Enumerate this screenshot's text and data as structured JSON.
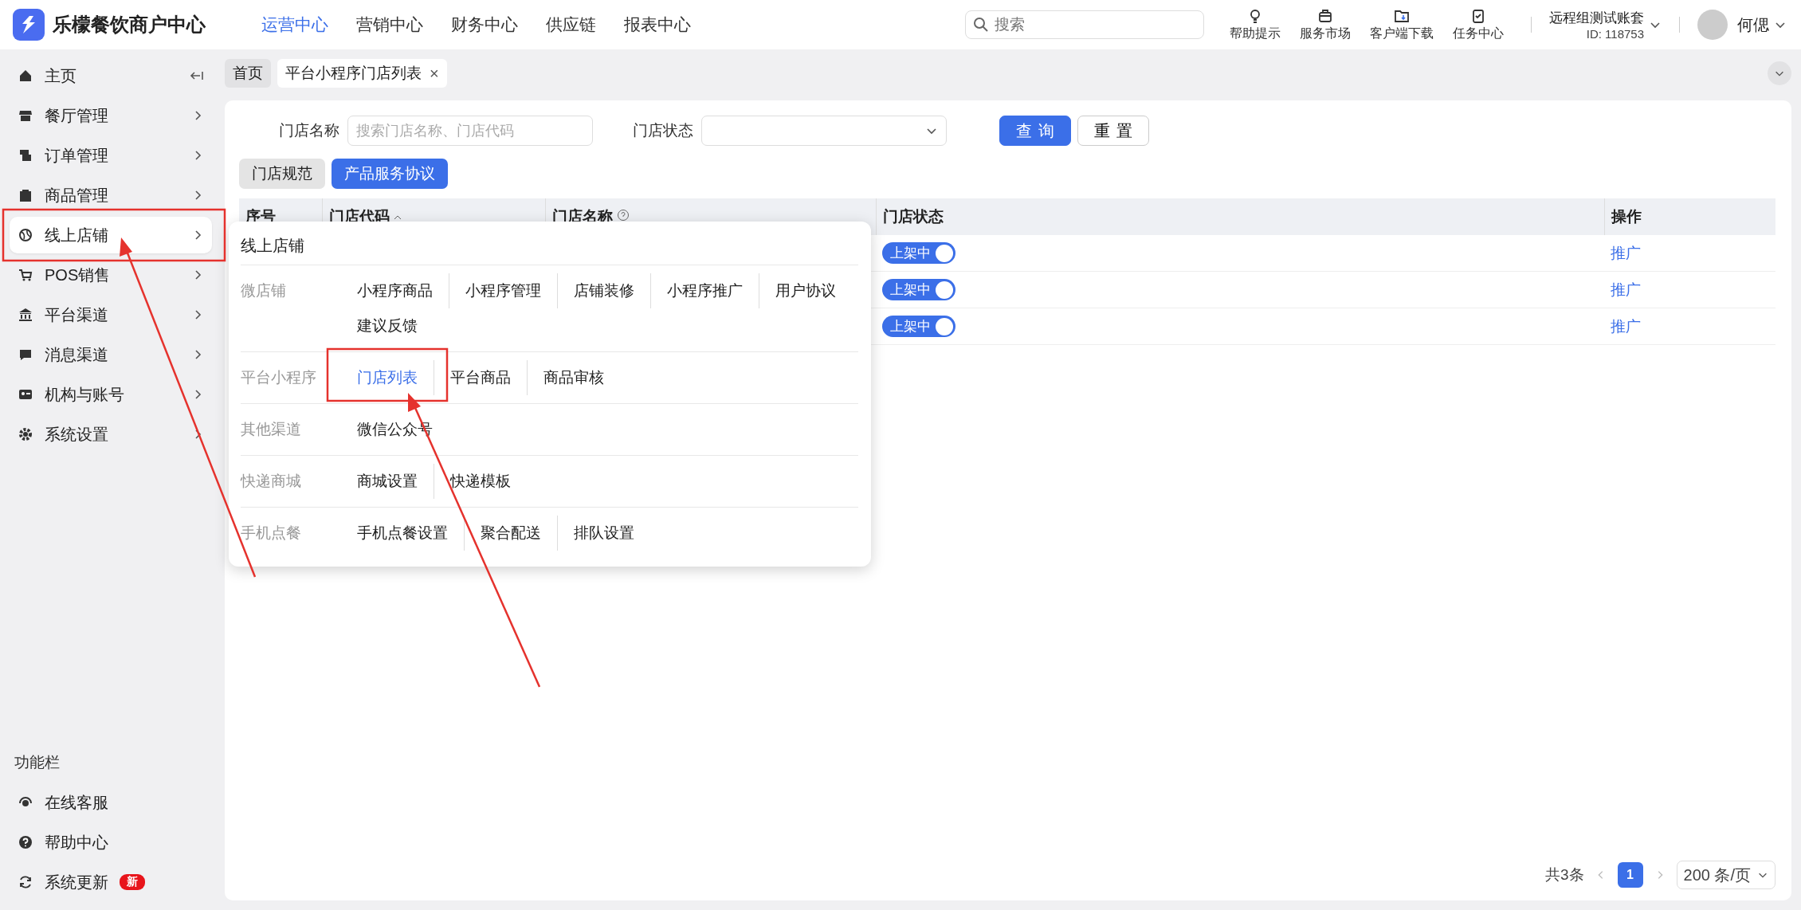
{
  "app": {
    "name": "乐檬餐饮商户中心"
  },
  "top_nav": [
    {
      "label": "运营中心",
      "selected": true
    },
    {
      "label": "营销中心",
      "selected": false
    },
    {
      "label": "财务中心",
      "selected": false
    },
    {
      "label": "供应链",
      "selected": false
    },
    {
      "label": "报表中心",
      "selected": false
    }
  ],
  "search": {
    "placeholder": "搜索"
  },
  "tools": [
    {
      "label": "帮助提示"
    },
    {
      "label": "服务市场"
    },
    {
      "label": "客户端下载"
    },
    {
      "label": "任务中心"
    }
  ],
  "account": {
    "name": "远程组测试账套",
    "id": "ID: 118753"
  },
  "user": {
    "name": "何偲"
  },
  "sidebar": {
    "items": [
      {
        "label": "主页",
        "kind": "collapse",
        "selected": false
      },
      {
        "label": "餐厅管理",
        "kind": "submenu",
        "selected": false
      },
      {
        "label": "订单管理",
        "kind": "submenu",
        "selected": false
      },
      {
        "label": "商品管理",
        "kind": "submenu",
        "selected": false
      },
      {
        "label": "线上店铺",
        "kind": "submenu",
        "selected": true
      },
      {
        "label": "POS销售",
        "kind": "submenu",
        "selected": false
      },
      {
        "label": "平台渠道",
        "kind": "submenu",
        "selected": false
      },
      {
        "label": "消息渠道",
        "kind": "submenu",
        "selected": false
      },
      {
        "label": "机构与账号",
        "kind": "submenu",
        "selected": false
      },
      {
        "label": "系统设置",
        "kind": "submenu",
        "selected": false
      }
    ],
    "footer_title": "功能栏",
    "footer_items": [
      {
        "label": "在线客服"
      },
      {
        "label": "帮助中心"
      },
      {
        "label": "系统更新",
        "badge": "新"
      }
    ]
  },
  "page_tabs": [
    {
      "label": "首页",
      "selected": false
    },
    {
      "label": "平台小程序门店列表",
      "selected": true,
      "close": "×"
    }
  ],
  "filters": [
    {
      "label": "门店名称",
      "kind": "text",
      "placeholder": "搜索门店名称、门店代码"
    },
    {
      "label": "门店状态",
      "kind": "select"
    }
  ],
  "buttons": [
    {
      "label": "查询",
      "kind": "primary"
    },
    {
      "label": "重置",
      "kind": "default"
    }
  ],
  "subtabs": [
    {
      "label": "门店规范",
      "selected": false
    },
    {
      "label": "产品服务协议",
      "selected": true
    }
  ],
  "table": {
    "columns": [
      {
        "label": "序号"
      },
      {
        "label": "门店代码",
        "sortable": true
      },
      {
        "label": "门店名称",
        "help": true
      },
      {
        "label": "门店状态"
      },
      {
        "label": "操作"
      }
    ],
    "rows": [
      {
        "status": "上架中",
        "on": true,
        "action": "推广"
      },
      {
        "status": "上架中",
        "on": true,
        "action": "推广"
      },
      {
        "status": "上架中",
        "on": true,
        "action": "推广"
      }
    ]
  },
  "pagination": {
    "total": "共3条",
    "pages": [
      {
        "label": "1",
        "selected": true
      }
    ],
    "page_size": "200 条/页"
  },
  "flyout": {
    "title": "线上店铺",
    "groups": [
      {
        "label": "微店铺",
        "links": [
          {
            "label": "小程序商品",
            "selected": false
          },
          {
            "label": "小程序管理",
            "selected": false
          },
          {
            "label": "店铺装修",
            "selected": false
          },
          {
            "label": "小程序推广",
            "selected": false
          },
          {
            "label": "用户协议",
            "selected": false
          },
          {
            "label": "建议反馈",
            "selected": false
          }
        ]
      },
      {
        "label": "平台小程序",
        "links": [
          {
            "label": "门店列表",
            "selected": true
          },
          {
            "label": "平台商品",
            "selected": false
          },
          {
            "label": "商品审核",
            "selected": false
          }
        ]
      },
      {
        "label": "其他渠道",
        "links": [
          {
            "label": "微信公众号",
            "selected": false
          }
        ]
      },
      {
        "label": "快递商城",
        "links": [
          {
            "label": "商城设置",
            "selected": false
          },
          {
            "label": "快递模板",
            "selected": false
          }
        ]
      },
      {
        "label": "手机点餐",
        "links": [
          {
            "label": "手机点餐设置",
            "selected": false
          },
          {
            "label": "聚合配送",
            "selected": false
          },
          {
            "label": "排队设置",
            "selected": false
          }
        ]
      }
    ]
  }
}
